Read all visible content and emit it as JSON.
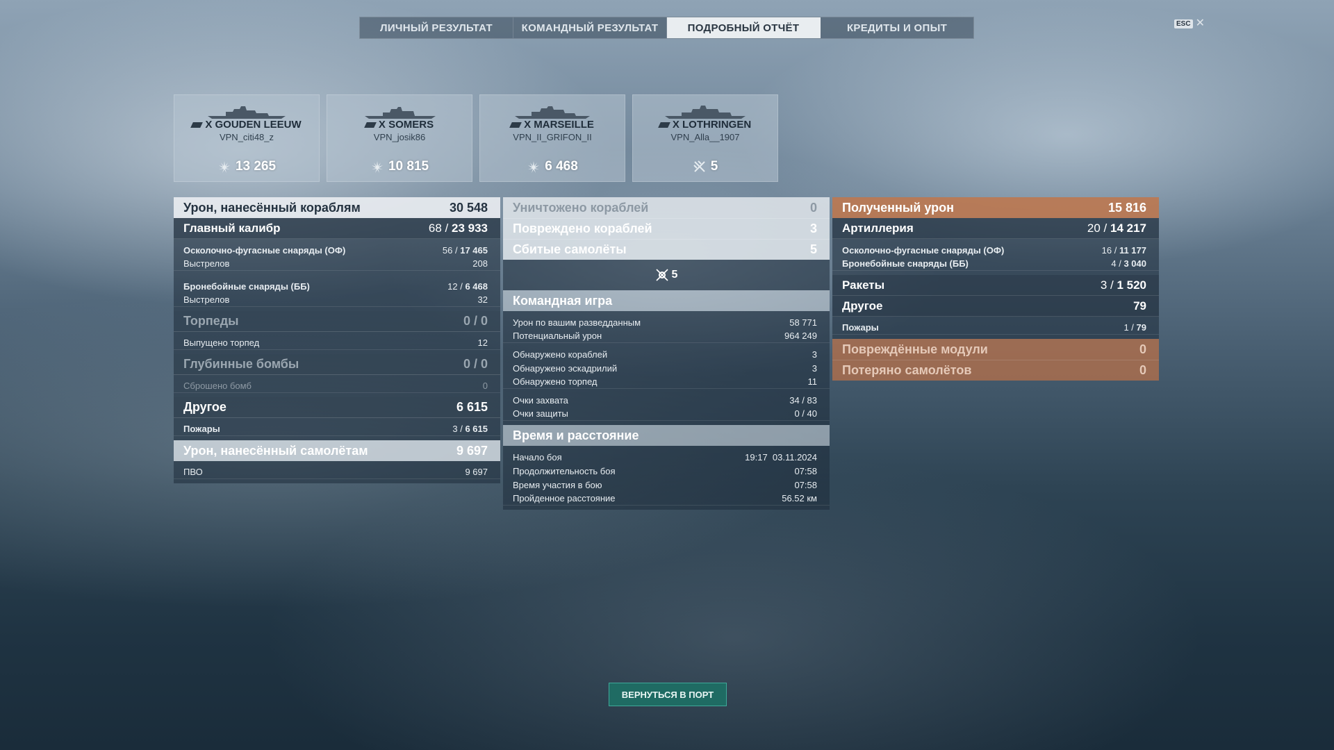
{
  "tabs": [
    "ЛИЧНЫЙ РЕЗУЛЬТАТ",
    "КОМАНДНЫЙ РЕЗУЛЬТАТ",
    "ПОДРОБНЫЙ ОТЧЁТ",
    "КРЕДИТЫ И ОПЫТ"
  ],
  "active_tab": "ПОДРОБНЫЙ ОТЧЁТ",
  "esc_label": "ESC",
  "cards": [
    {
      "ship": "X GOUDEN LEEUW",
      "player": "VPN_citi48_z",
      "score": "13 265",
      "icon": "damage-icon"
    },
    {
      "ship": "X SOMERS",
      "player": "VPN_josik86",
      "score": "10 815",
      "icon": "damage-icon"
    },
    {
      "ship": "X MARSEILLE",
      "player": "VPN_II_GRIFON_II",
      "score": "6 468",
      "icon": "damage-icon"
    },
    {
      "ship": "X LOTHRINGEN",
      "player": "VPN_Alla__1907",
      "score": "5",
      "icon": "planes-shot-icon"
    }
  ],
  "left": {
    "ship_damage": {
      "label": "Урон, нанесённый кораблям",
      "value": "30 548"
    },
    "main_battery": {
      "label": "Главный калибр",
      "hits": "68",
      "damage": "23 933"
    },
    "he": {
      "label": "Осколочно-фугасные снаряды (ОФ)",
      "hits": "56",
      "damage": "17 465"
    },
    "he_shots": {
      "label": "Выстрелов",
      "value": "208"
    },
    "ap": {
      "label": "Бронебойные снаряды (ББ)",
      "hits": "12",
      "damage": "6 468"
    },
    "ap_shots": {
      "label": "Выстрелов",
      "value": "32"
    },
    "torpedoes": {
      "label": "Торпеды",
      "value": "0 / 0"
    },
    "torps_launched": {
      "label": "Выпущено торпед",
      "value": "12"
    },
    "depth": {
      "label": "Глубинные бомбы",
      "value": "0 / 0"
    },
    "bombs_dropped": {
      "label": "Сброшено бомб",
      "value": "0"
    },
    "other": {
      "label": "Другое",
      "value": "6 615"
    },
    "fires": {
      "label": "Пожары",
      "hits": "3",
      "damage": "6 615"
    },
    "plane_damage": {
      "label": "Урон, нанесённый самолётам",
      "value": "9 697"
    },
    "aa": {
      "label": "ПВО",
      "value": "9 697"
    }
  },
  "middle": {
    "destroyed": {
      "label": "Уничтожено кораблей",
      "value": "0"
    },
    "damaged": {
      "label": "Повреждено кораблей",
      "value": "3"
    },
    "planes_shot": {
      "label": "Сбитые самолёты",
      "value": "5"
    },
    "planes_icon_value": "5",
    "team_header": "Командная игра",
    "team": [
      {
        "label": "Урон по вашим разведданным",
        "value": "58 771"
      },
      {
        "label": "Потенциальный урон",
        "value": "964 249"
      },
      {
        "label": "Обнаружено кораблей",
        "value": "3"
      },
      {
        "label": "Обнаружено эскадрилий",
        "value": "3"
      },
      {
        "label": "Обнаружено торпед",
        "value": "11"
      },
      {
        "label": "Очки захвата",
        "value": "34 / 83"
      },
      {
        "label": "Очки защиты",
        "value": "0 / 40"
      }
    ],
    "time_header": "Время и расстояние",
    "time": [
      {
        "label": "Начало боя",
        "value": "19:17  03.11.2024"
      },
      {
        "label": "Продолжительность боя",
        "value": "07:58"
      },
      {
        "label": "Время участия в бою",
        "value": "07:58"
      },
      {
        "label": "Пройденное расстояние",
        "value": "56.52 км"
      }
    ]
  },
  "right": {
    "received": {
      "label": "Полученный урон",
      "value": "15 816"
    },
    "artillery": {
      "label": "Артиллерия",
      "hits": "20",
      "damage": "14 217"
    },
    "he": {
      "label": "Осколочно-фугасные снаряды (ОФ)",
      "hits": "16",
      "damage": "11 177"
    },
    "ap": {
      "label": "Бронебойные снаряды (ББ)",
      "hits": "4",
      "damage": "3 040"
    },
    "rockets": {
      "label": "Ракеты",
      "hits": "3",
      "damage": "1 520"
    },
    "other": {
      "label": "Другое",
      "value": "79"
    },
    "fires": {
      "label": "Пожары",
      "hits": "1",
      "damage": "79"
    },
    "modules": {
      "label": "Повреждённые модули",
      "value": "0"
    },
    "planes_lost": {
      "label": "Потеряно самолётов",
      "value": "0"
    }
  },
  "return_button": "ВЕРНУТЬСЯ В ПОРТ",
  "colors": {
    "accent_orange": "#bc7850",
    "return_button": "#1f6b63",
    "active_tab": "#e9edf0"
  }
}
